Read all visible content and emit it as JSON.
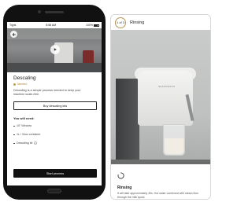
{
  "phone1": {
    "status_bar": {
      "carrier": "Tigris",
      "time": "8:58 AM",
      "battery": "100%"
    },
    "screen_title": "Descaling",
    "badge": "Needed",
    "description": "Descaling is a simple process needed to keep your machine scale-free.",
    "buy_button_label": "Buy descaling kits",
    "need_title": "You will need:",
    "need_items": [
      {
        "label": "10\" Window"
      },
      {
        "label": "1L / 34oz container"
      },
      {
        "label": "Descaling kit"
      }
    ],
    "start_button_label": "Start process"
  },
  "phone2": {
    "step_badge": "1 of 3",
    "header_title": "Rinsing",
    "brand": "NESPRESSO",
    "panel_title": "Rinsing",
    "panel_description": "It will take approximately 40s. Hot water combined with steam flow through the milk spout."
  },
  "colors": {
    "accent_gold": "#b69657",
    "button_dark": "#111111"
  }
}
